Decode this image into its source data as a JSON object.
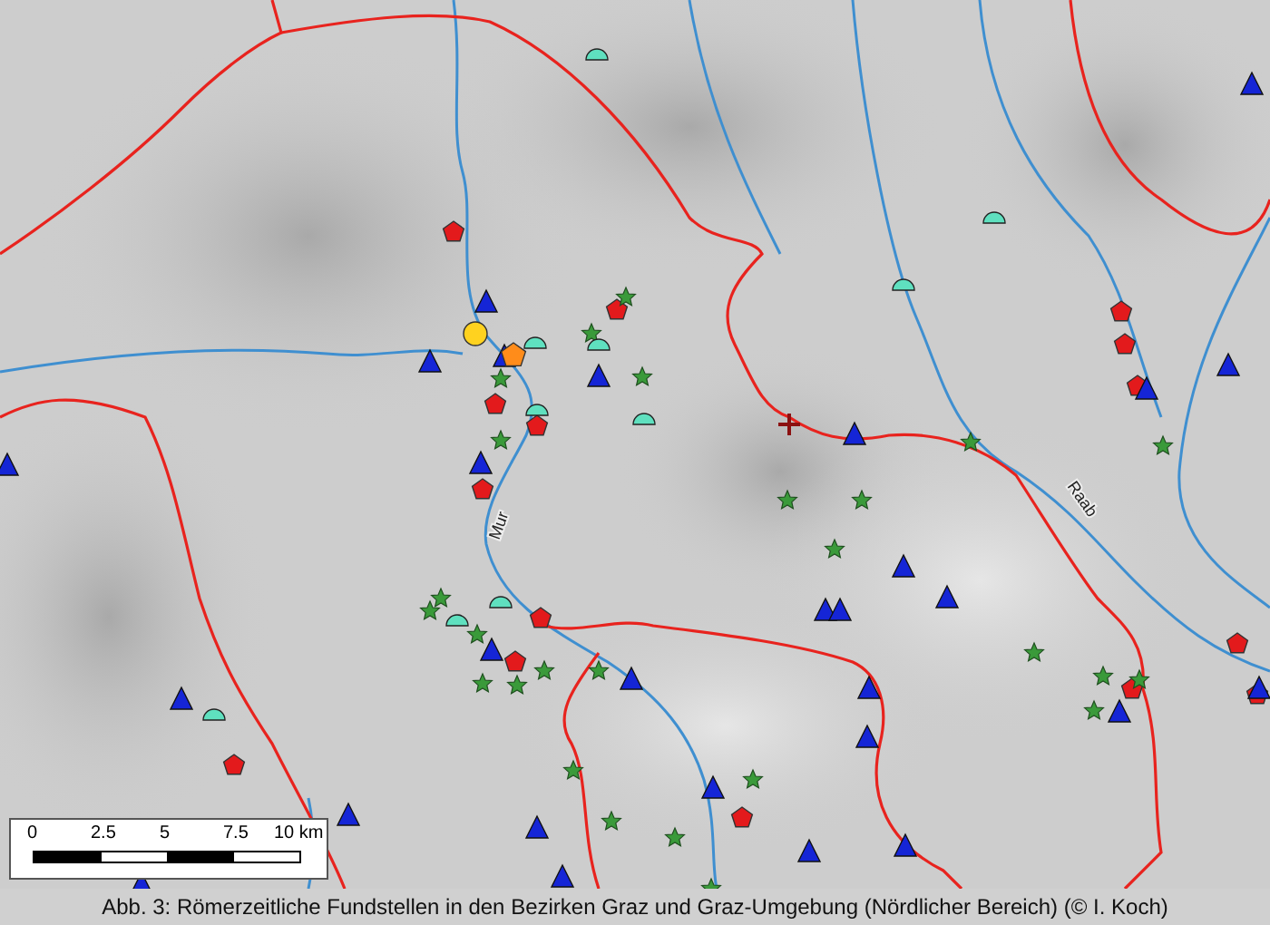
{
  "map": {
    "river_labels": [
      "Mur",
      "Raab"
    ]
  },
  "scale_bar": {
    "ticks": [
      "0",
      "2.5",
      "5",
      "7.5",
      "10 km"
    ]
  },
  "caption": "Abb. 3: Römerzeitliche Fundstellen in den Bezirken Graz und Graz-Umgebung (Nördlicher Bereich) (© I. Koch)"
}
